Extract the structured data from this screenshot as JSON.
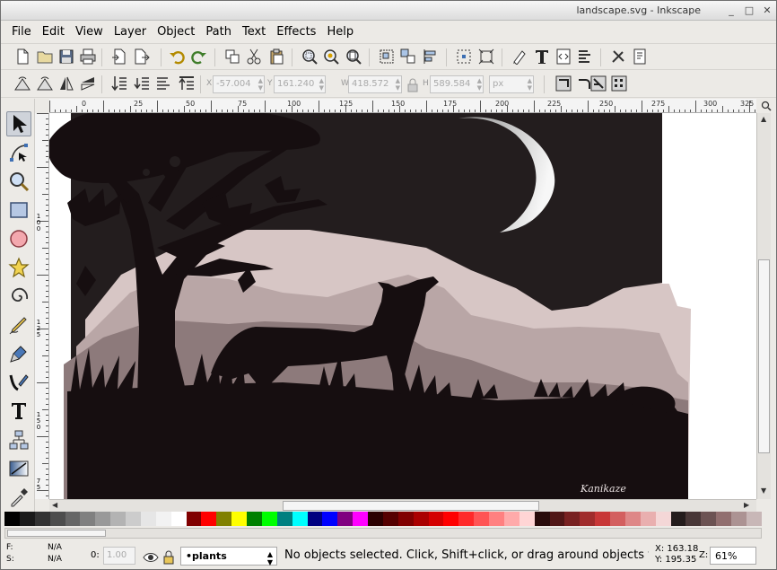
{
  "window": {
    "title": "landscape.svg - Inkscape",
    "minimize_glyph": "_",
    "maximize_glyph": "□",
    "close_glyph": "✕"
  },
  "menu": {
    "file": "File",
    "edit": "Edit",
    "view": "View",
    "layer": "Layer",
    "object": "Object",
    "path": "Path",
    "text": "Text",
    "effects": "Effects",
    "help": "Help"
  },
  "selector_toolbar": {
    "x_label": "X",
    "x_value": "-57.004",
    "y_label": "Y",
    "y_value": "161.240",
    "w_label": "W",
    "w_value": "418.572",
    "h_label": "H",
    "h_value": "589.584",
    "unit": "px"
  },
  "ruler": {
    "h_labels": [
      "0",
      "25",
      "50",
      "75",
      "100",
      "125",
      "150",
      "175",
      "200",
      "225",
      "250",
      "275",
      "300",
      "325"
    ],
    "v_labels": [
      "1",
      "0",
      "0",
      "1",
      "2",
      "5",
      "1",
      "5",
      "0",
      "7",
      "5"
    ]
  },
  "canvas": {
    "signature": "Kanikaze",
    "colors": {
      "sky": "#231d1e",
      "far_hills": "#d7c6c5",
      "mid_hills": "#b9a6a6",
      "near_hills": "#8d7a7b",
      "silhouette": "#160e10",
      "moon_light": "#f7f7f7",
      "moon_dark": "#8f8f8f"
    }
  },
  "palette": [
    "#000000",
    "#1a1a1a",
    "#333333",
    "#4d4d4d",
    "#666666",
    "#808080",
    "#999999",
    "#b3b3b3",
    "#cccccc",
    "#e6e6e6",
    "#f2f2f2",
    "#ffffff",
    "#800000",
    "#ff0000",
    "#808000",
    "#ffff00",
    "#008000",
    "#00ff00",
    "#008080",
    "#00ffff",
    "#000080",
    "#0000ff",
    "#800080",
    "#ff00ff",
    "#2b0000",
    "#550000",
    "#800000",
    "#aa0000",
    "#d40000",
    "#ff0000",
    "#ff2a2a",
    "#ff5555",
    "#ff8080",
    "#ffaaaa",
    "#ffd5d5",
    "#280b0b",
    "#501616",
    "#782121",
    "#a02c2c",
    "#c83737",
    "#d35f5f",
    "#de8787",
    "#e9afaf",
    "#f4d7d7",
    "#241c1c",
    "#483737",
    "#6c5353",
    "#916f6f",
    "#ac9393",
    "#c8b7b7"
  ],
  "status": {
    "fill_label": "F:",
    "fill_value": "N/A",
    "stroke_label": "S:",
    "stroke_value": "N/A",
    "opacity_label": "0:",
    "opacity_value": "1.00",
    "layer_name": "•plants",
    "message": "No objects selected. Click, Shift+click, or drag around objects to select.",
    "x_coord": "X: 163.18",
    "y_coord": "Y: 195.35",
    "zoom_label": "Z:",
    "zoom_value": "61%"
  }
}
